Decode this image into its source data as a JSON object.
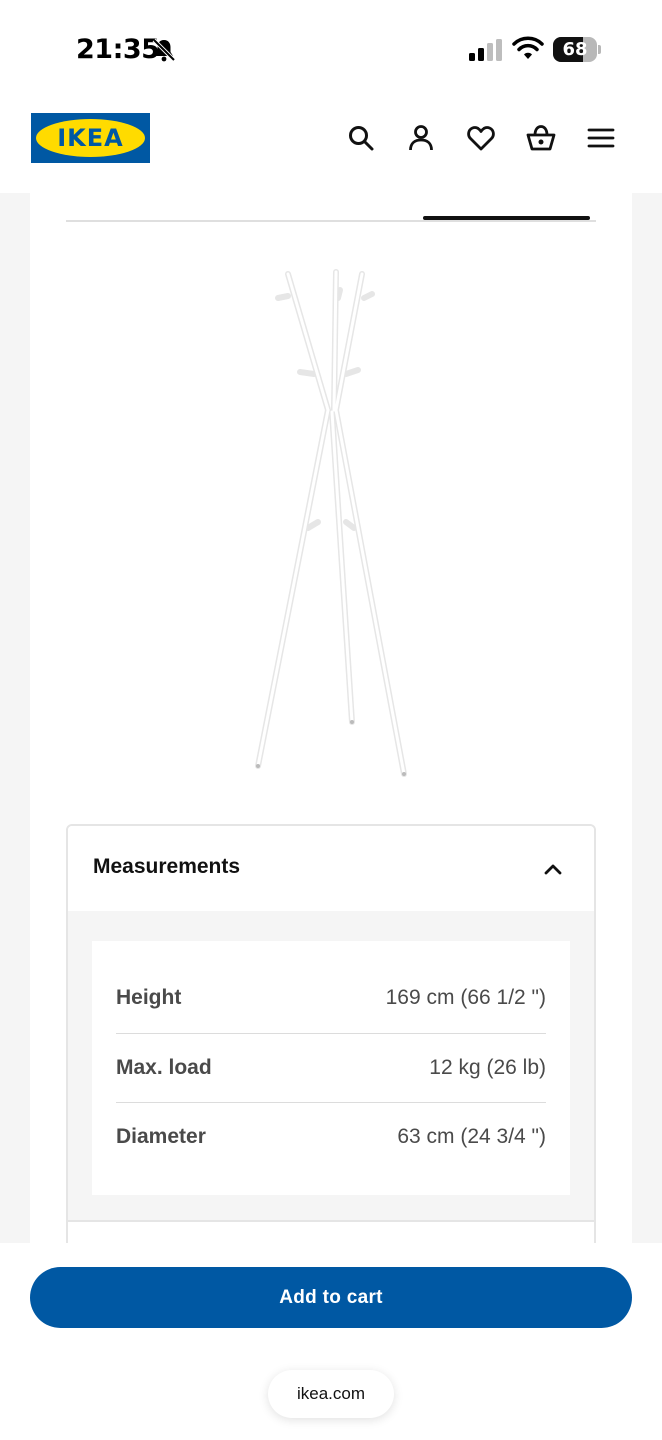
{
  "status_bar": {
    "time": "21:35",
    "battery_level": "68",
    "battery_fraction": 0.68,
    "icons": [
      "bell-slash-icon",
      "cellular-signal-icon",
      "wifi-icon",
      "battery-icon"
    ]
  },
  "header": {
    "logo_text": "IKEA",
    "brand_colors": {
      "blue": "#0058a3",
      "yellow": "#ffdb00"
    },
    "icons": [
      "search-icon",
      "account-icon",
      "heart-icon",
      "basket-icon",
      "menu-icon"
    ]
  },
  "measurements": {
    "title": "Measurements",
    "expanded": true,
    "rows": [
      {
        "label": "Height",
        "value": "169 cm (66 1/2 \")"
      },
      {
        "label": "Max. load",
        "value": "12 kg (26 lb)"
      },
      {
        "label": "Diameter",
        "value": "63 cm (24 3/4 \")"
      }
    ]
  },
  "cart": {
    "add_label": "Add to cart",
    "button_color": "#0058a3"
  },
  "browser": {
    "url": "ikea.com"
  }
}
